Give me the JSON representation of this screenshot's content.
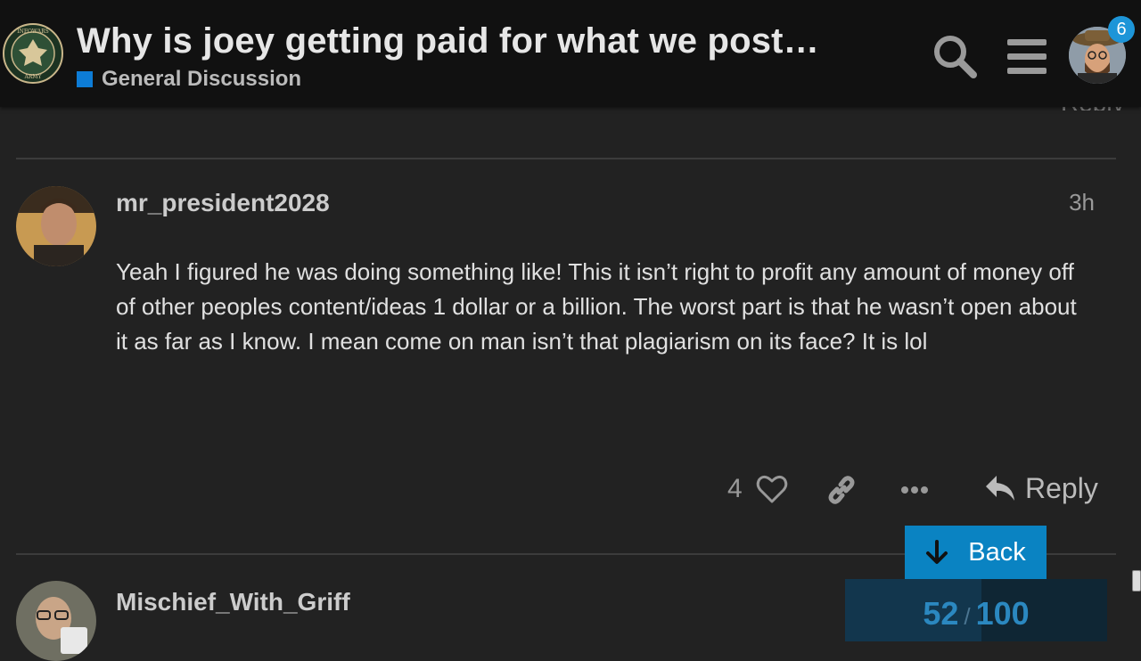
{
  "header": {
    "title": "Why is joey getting paid for what we post…",
    "category": {
      "label": "General Discussion",
      "color": "#0d7cd6"
    },
    "logo_icon": "infowars-army-seal-icon",
    "notification_count": "6",
    "partial_reply_text": "Reply"
  },
  "post": {
    "username": "mr_president2028",
    "date": "3h",
    "body": "Yeah I figured he was doing something like! This it isn’t right to profit any amount of money off of other peoples content/ideas 1 dollar or a billion. The worst part is that he wasn’t open about it as far as I know. I mean come on man isn’t that plagiarism on its face? It is lol",
    "like_count": "4",
    "reply_label": "Reply"
  },
  "next_post": {
    "username": "Mischief_With_Griff"
  },
  "timeline": {
    "back_label": "Back",
    "current": "52",
    "separator": "/",
    "total": "100",
    "progress_fraction": 0.52
  },
  "colors": {
    "background": "#222222",
    "header": "#111111",
    "accent": "#0a83c2"
  }
}
